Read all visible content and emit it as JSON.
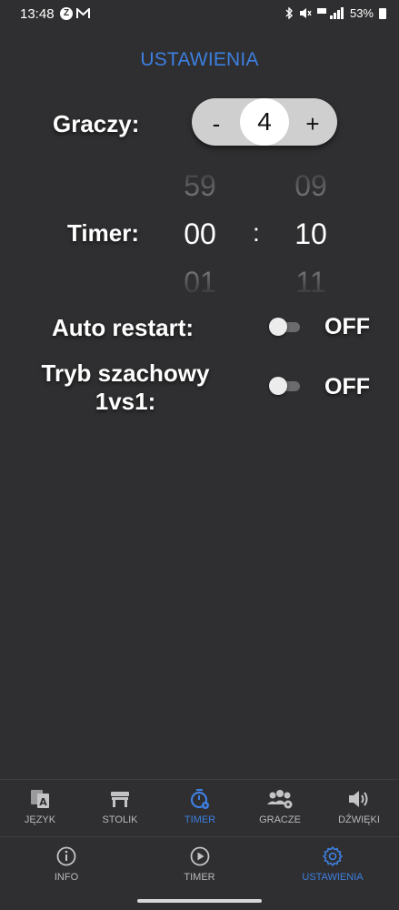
{
  "status_bar": {
    "time": "13:48",
    "battery": "53%"
  },
  "header": {
    "title": "USTAWIENIA"
  },
  "players": {
    "label": "Graczy:",
    "minus": "-",
    "value": "4",
    "plus": "+"
  },
  "timer": {
    "label": "Timer:",
    "separator": ":",
    "minutes": {
      "prev": "59",
      "current": "00",
      "next": "01"
    },
    "seconds": {
      "prev": "09",
      "current": "10",
      "next": "11"
    }
  },
  "auto_restart": {
    "label": "Auto restart:",
    "state": "OFF"
  },
  "chess_mode": {
    "label_line1": "Tryb szachowy",
    "label_line2": "1vs1:",
    "state": "OFF"
  },
  "top_tabs": [
    {
      "label": "JĘZYK",
      "icon": "language-icon"
    },
    {
      "label": "STOLIK",
      "icon": "table-icon"
    },
    {
      "label": "TIMER",
      "icon": "timer-settings-icon"
    },
    {
      "label": "GRACZE",
      "icon": "players-settings-icon"
    },
    {
      "label": "DŹWIĘKI",
      "icon": "volume-icon"
    }
  ],
  "bottom_tabs": [
    {
      "label": "INFO",
      "icon": "info-icon"
    },
    {
      "label": "TIMER",
      "icon": "play-icon"
    },
    {
      "label": "USTAWIENIA",
      "icon": "gear-icon"
    }
  ],
  "colors": {
    "accent": "#3d7fe0",
    "background": "#2f2f31"
  }
}
